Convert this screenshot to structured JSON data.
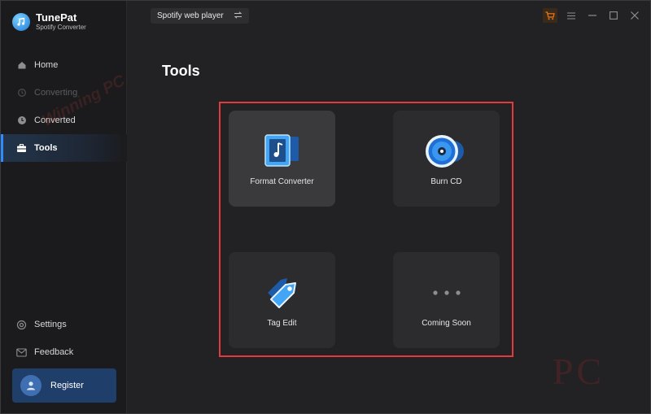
{
  "app": {
    "name": "TunePat",
    "subtitle": "Spotify Converter"
  },
  "sidebar": {
    "items": [
      {
        "label": "Home",
        "icon": "home-icon",
        "state": "normal"
      },
      {
        "label": "Converting",
        "icon": "sync-icon",
        "state": "disabled"
      },
      {
        "label": "Converted",
        "icon": "clock-icon",
        "state": "normal"
      },
      {
        "label": "Tools",
        "icon": "toolbox-icon",
        "state": "active"
      }
    ],
    "bottom": [
      {
        "label": "Settings",
        "icon": "gear-icon"
      },
      {
        "label": "Feedback",
        "icon": "mail-icon"
      }
    ],
    "register_label": "Register"
  },
  "topbar": {
    "source_label": "Spotify web player",
    "source_icon": "switch-icon"
  },
  "main": {
    "title": "Tools",
    "tools": [
      {
        "label": "Format Converter",
        "icon": "format-converter-icon"
      },
      {
        "label": "Burn CD",
        "icon": "burn-cd-icon"
      },
      {
        "label": "Tag Edit",
        "icon": "tag-edit-icon"
      },
      {
        "label": "Coming Soon",
        "icon": "more-dots-icon"
      }
    ]
  },
  "watermark": {
    "text": "Winning PC",
    "logo_text": "PC"
  },
  "colors": {
    "accent": "#2f8cff",
    "highlight_border": "#e23b3f",
    "cart": "#f07a1a"
  }
}
